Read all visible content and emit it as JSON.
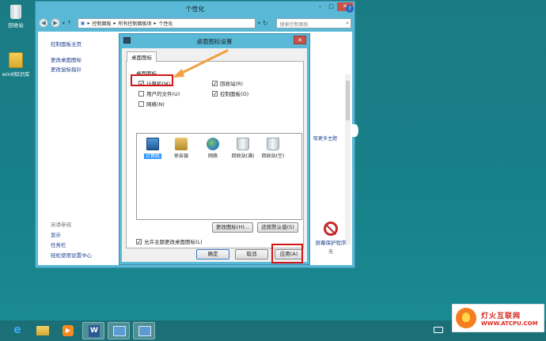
{
  "desktop": {
    "icons": [
      {
        "label": "回收站"
      },
      {
        "label": "win8知识库"
      }
    ]
  },
  "cp_window": {
    "title": "个性化",
    "breadcrumb": [
      "控制面板",
      "所有控制面板项",
      "个性化"
    ],
    "search_placeholder": "搜索控制面板",
    "sidebar": {
      "home": "控制面板主页",
      "links": [
        "更改桌面图标",
        "更改鼠标指针"
      ],
      "see_also_heading": "另请参阅",
      "see_also": [
        "显示",
        "任务栏",
        "轻松使用设置中心"
      ]
    },
    "more_themes_fragment": "取更多主题",
    "screensaver": {
      "label": "屏幕保护程序",
      "value": "无"
    }
  },
  "dialog": {
    "title": "桌面图标设置",
    "tab": "桌面图标",
    "group_label": "桌面图标",
    "checkboxes": [
      {
        "label": "计算机(M)",
        "checked": "✓"
      },
      {
        "label": "回收站(R)",
        "checked": "✓"
      },
      {
        "label": "用户的文件(U)",
        "checked": ""
      },
      {
        "label": "控制面板(O)",
        "checked": "✓"
      },
      {
        "label": "网络(N)",
        "checked": ""
      }
    ],
    "icons": [
      {
        "label": "计算机",
        "icon": "computer-icon"
      },
      {
        "label": "徐亲银",
        "icon": "user-folder-icon"
      },
      {
        "label": "网络",
        "icon": "network-icon"
      },
      {
        "label": "回收站(满)",
        "icon": "recycle-full-icon"
      },
      {
        "label": "回收站(空)",
        "icon": "recycle-empty-icon"
      }
    ],
    "change_icon_button": "更改图标(H)...",
    "restore_default_button": "还原默认值(S)",
    "allow_themes_label": "允许主题更改桌面图标(L)",
    "allow_themes_checked": "✓",
    "ok_button": "确定",
    "cancel_button": "取消",
    "apply_button": "应用(A)"
  },
  "watermark": {
    "cn": "灯火互联网",
    "en": "WWW.ATCPU.COM"
  },
  "colors": {
    "highlight": "#d21414",
    "arrow": "#f0a040",
    "desktop": "#1a7f88"
  }
}
